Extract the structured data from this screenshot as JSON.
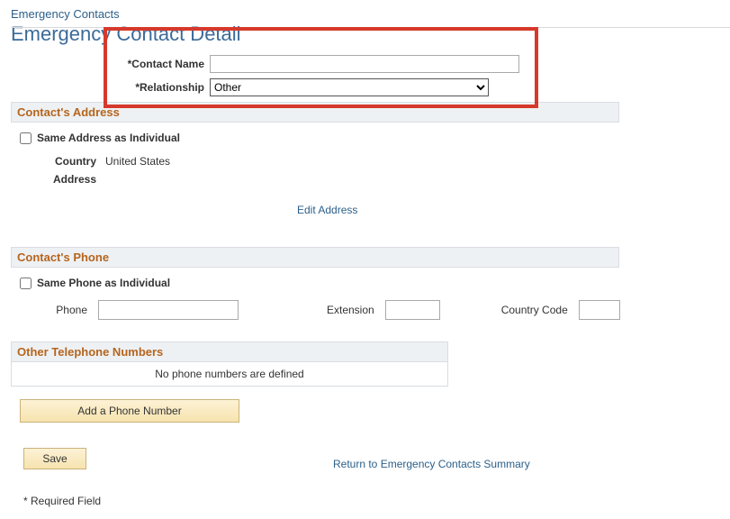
{
  "breadcrumb": "Emergency Contacts",
  "page_title": "Emergency Contact Detail",
  "fields": {
    "contact_name_label": "*Contact Name",
    "contact_name_value": "",
    "relationship_label": "*Relationship",
    "relationship_value": "Other"
  },
  "address_section": {
    "title": "Contact's Address",
    "same_as_label": "Same Address as Individual",
    "same_as_checked": false,
    "country_label": "Country",
    "country_value": "United States",
    "address_label": "Address",
    "address_value": "",
    "edit_link": "Edit Address"
  },
  "phone_section": {
    "title": "Contact's Phone",
    "same_as_label": "Same Phone as Individual",
    "same_as_checked": false,
    "phone_label": "Phone",
    "phone_value": "",
    "extension_label": "Extension",
    "extension_value": "",
    "country_code_label": "Country Code",
    "country_code_value": ""
  },
  "other_phones": {
    "title": "Other Telephone Numbers",
    "empty_msg": "No phone numbers are defined",
    "add_button": "Add a Phone Number"
  },
  "actions": {
    "save": "Save",
    "return_link": "Return to Emergency Contacts Summary",
    "required_note": "* Required Field"
  }
}
